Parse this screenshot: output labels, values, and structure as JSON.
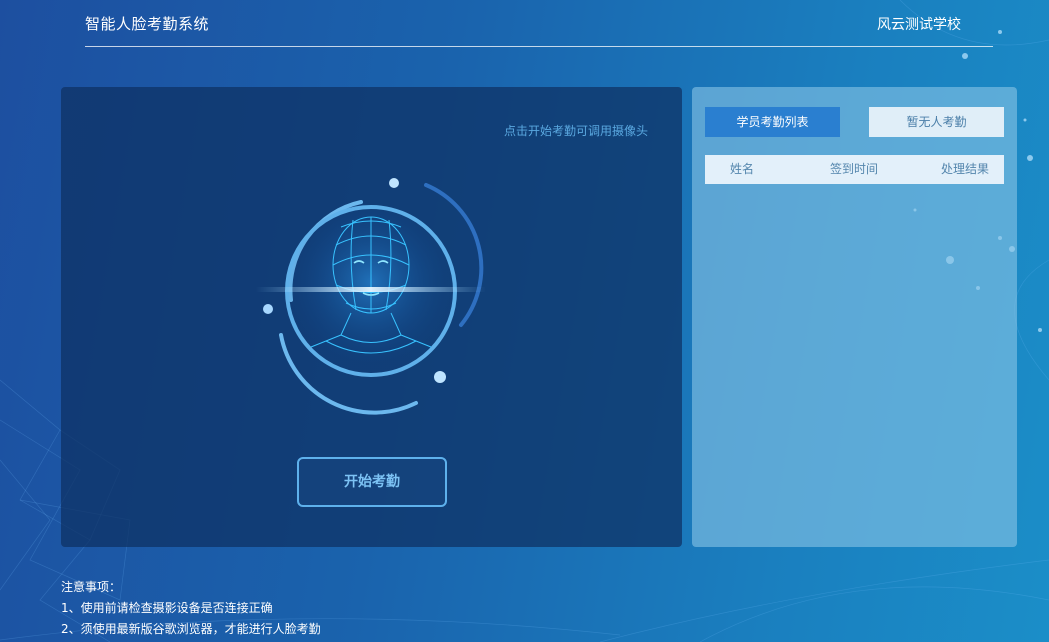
{
  "header": {
    "title": "智能人脸考勤系统",
    "school": "风云测试学校"
  },
  "camera": {
    "hint": "点击开始考勤可调用摄像头",
    "start_label": "开始考勤"
  },
  "attendance": {
    "tabs": [
      "学员考勤列表",
      "暂无人考勤"
    ],
    "columns": [
      "姓名",
      "签到时间",
      "处理结果"
    ],
    "rows": []
  },
  "notes": {
    "title": "注意事项：",
    "items": [
      "1、使用前请检查摄影设备是否连接正确",
      "2、须使用最新版谷歌浏览器，才能进行人脸考勤"
    ]
  },
  "colors": {
    "accent": "#2a7fd0",
    "button_border": "#5eb1ec"
  },
  "icons": {
    "face": "face-scan-icon"
  }
}
